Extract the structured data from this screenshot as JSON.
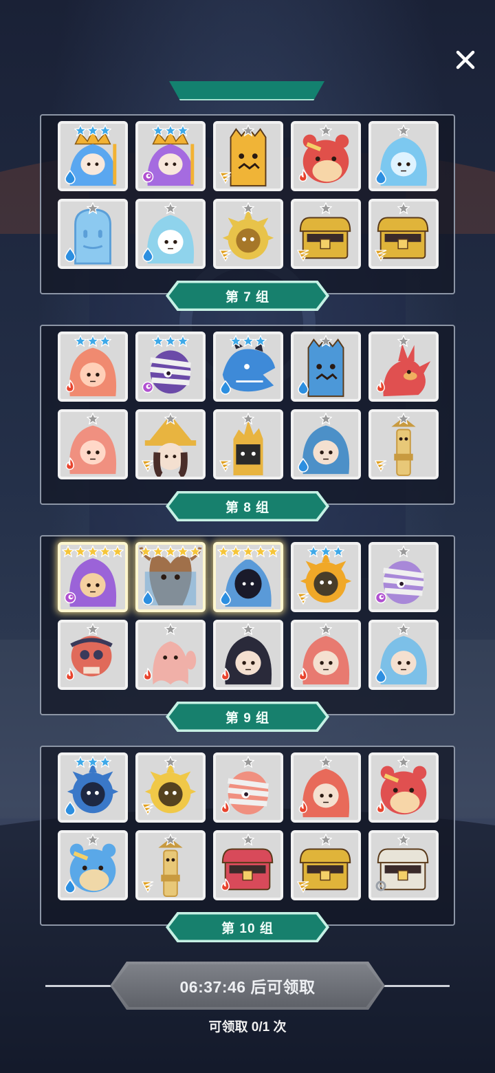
{
  "close_label": "✕",
  "groups": [
    {
      "label": "第 7 组",
      "cards": [
        {
          "stars": 3,
          "star_color": "blue",
          "element": "water",
          "color": "#5aa7f0",
          "accent": "#f2b233",
          "shape": "crown"
        },
        {
          "stars": 3,
          "star_color": "blue",
          "element": "dark",
          "color": "#a56be0",
          "accent": "#f2b233",
          "shape": "crown"
        },
        {
          "stars": 1,
          "star_color": "gray",
          "element": "wind",
          "color": "#f0b437",
          "accent": "#7a4a1a",
          "shape": "stump"
        },
        {
          "stars": 1,
          "star_color": "gray",
          "element": "fire",
          "color": "#e0504a",
          "accent": "#f7d6a8",
          "shape": "bear"
        },
        {
          "stars": 1,
          "star_color": "gray",
          "element": "water",
          "color": "#7cc8f0",
          "accent": "#dff3ff",
          "shape": "girl"
        },
        {
          "stars": 1,
          "star_color": "gray",
          "element": "water",
          "color": "#8cc9f0",
          "accent": "#5b9fd8",
          "shape": "blob"
        },
        {
          "stars": 1,
          "star_color": "gray",
          "element": "water",
          "color": "#8fd3ec",
          "accent": "#ffffff",
          "shape": "girl"
        },
        {
          "stars": 1,
          "star_color": "gray",
          "element": "wind",
          "color": "#e8c34a",
          "accent": "#9a6a22",
          "shape": "sun"
        },
        {
          "stars": 1,
          "star_color": "gray",
          "element": "wind",
          "color": "#e0b43a",
          "accent": "#3a2a2a",
          "shape": "chest"
        },
        {
          "stars": 1,
          "star_color": "gray",
          "element": "wind",
          "color": "#e0b43a",
          "accent": "#3a2a2a",
          "shape": "chest"
        }
      ]
    },
    {
      "label": "第 8 组",
      "cards": [
        {
          "stars": 3,
          "star_color": "blue",
          "element": "fire",
          "color": "#f08a70",
          "accent": "#ffd0b8",
          "shape": "girl"
        },
        {
          "stars": 3,
          "star_color": "blue",
          "element": "dark",
          "color": "#6b4aa8",
          "accent": "#f0f0f0",
          "shape": "mummy"
        },
        {
          "stars": 3,
          "star_color": "blue",
          "element": "water",
          "color": "#3e8ad8",
          "accent": "#2a2a3a",
          "shape": "dragon"
        },
        {
          "stars": 1,
          "star_color": "gray",
          "element": "water",
          "color": "#4c98d8",
          "accent": "#1e3a5a",
          "shape": "stump"
        },
        {
          "stars": 1,
          "star_color": "gray",
          "element": "fire",
          "color": "#e05050",
          "accent": "#f0b060",
          "shape": "bird"
        },
        {
          "stars": 1,
          "star_color": "gray",
          "element": "fire",
          "color": "#f09080",
          "accent": "#ffd8c8",
          "shape": "girl"
        },
        {
          "stars": 1,
          "star_color": "gray",
          "element": "wind",
          "color": "#e8b440",
          "accent": "#4a2e2a",
          "shape": "witch"
        },
        {
          "stars": 1,
          "star_color": "gray",
          "element": "wind",
          "color": "#e8b440",
          "accent": "#2a2a2a",
          "shape": "tower"
        },
        {
          "stars": 1,
          "star_color": "gray",
          "element": "water",
          "color": "#4c90c8",
          "accent": "#f4e0d0",
          "shape": "girl"
        },
        {
          "stars": 1,
          "star_color": "gray",
          "element": "wind",
          "color": "#e8c878",
          "accent": "#c89a40",
          "shape": "totem"
        }
      ]
    },
    {
      "label": "第 9 组",
      "cards": [
        {
          "stars": 5,
          "star_color": "gold",
          "element": "dark",
          "color": "#9b63d8",
          "accent": "#f4d0a0",
          "shape": "girl",
          "glow": true
        },
        {
          "stars": 5,
          "star_color": "gold",
          "element": "water",
          "color": "#6aa8d8",
          "accent": "#a0704a",
          "shape": "horse",
          "glow": true
        },
        {
          "stars": 5,
          "star_color": "gold",
          "element": "water",
          "color": "#5a9ad8",
          "accent": "#1a1a2a",
          "shape": "hood",
          "glow": true
        },
        {
          "stars": 3,
          "star_color": "blue",
          "element": "wind",
          "color": "#f0a828",
          "accent": "#2a2a2a",
          "shape": "sun"
        },
        {
          "stars": 1,
          "star_color": "gray",
          "element": "dark",
          "color": "#a888d8",
          "accent": "#f0f0f0",
          "shape": "mummy"
        },
        {
          "stars": 1,
          "star_color": "gray",
          "element": "fire",
          "color": "#e06a5a",
          "accent": "#3a3a5a",
          "shape": "skull"
        },
        {
          "stars": 1,
          "star_color": "gray",
          "element": "fire",
          "color": "#f0b0a8",
          "accent": "#ffffff",
          "shape": "ghost"
        },
        {
          "stars": 1,
          "star_color": "gray",
          "element": "fire",
          "color": "#2a2a3a",
          "accent": "#f4e0d0",
          "shape": "girl"
        },
        {
          "stars": 1,
          "star_color": "gray",
          "element": "fire",
          "color": "#e87a70",
          "accent": "#f4e0d0",
          "shape": "girl"
        },
        {
          "stars": 1,
          "star_color": "gray",
          "element": "water",
          "color": "#7cc0e8",
          "accent": "#f4e0d0",
          "shape": "girl"
        }
      ]
    },
    {
      "label": "第 10 组",
      "cards": [
        {
          "stars": 3,
          "star_color": "blue",
          "element": "water",
          "color": "#3a78c8",
          "accent": "#1a1a2a",
          "shape": "sun"
        },
        {
          "stars": 1,
          "star_color": "gray",
          "element": "wind",
          "color": "#f0c848",
          "accent": "#3a2a1a",
          "shape": "sun"
        },
        {
          "stars": 1,
          "star_color": "gray",
          "element": "fire",
          "color": "#f09080",
          "accent": "#f0f0f0",
          "shape": "mummy"
        },
        {
          "stars": 1,
          "star_color": "gray",
          "element": "fire",
          "color": "#e86a5a",
          "accent": "#f4e0d0",
          "shape": "girl"
        },
        {
          "stars": 1,
          "star_color": "gray",
          "element": "fire",
          "color": "#e05050",
          "accent": "#f7d6a8",
          "shape": "bear"
        },
        {
          "stars": 1,
          "star_color": "gray",
          "element": "water",
          "color": "#5aa8e8",
          "accent": "#f0d8a8",
          "shape": "bear"
        },
        {
          "stars": 1,
          "star_color": "gray",
          "element": "wind",
          "color": "#e8c878",
          "accent": "#c89a40",
          "shape": "totem"
        },
        {
          "stars": 1,
          "star_color": "gray",
          "element": "fire",
          "color": "#d84a5a",
          "accent": "#3a2a2a",
          "shape": "chest"
        },
        {
          "stars": 1,
          "star_color": "gray",
          "element": "wind",
          "color": "#e0b43a",
          "accent": "#3a2a2a",
          "shape": "chest"
        },
        {
          "stars": 1,
          "star_color": "gray",
          "element": "light",
          "color": "#e8e4d8",
          "accent": "#3a2a2a",
          "shape": "chest"
        }
      ]
    }
  ],
  "claim_button_label": "06:37:46 后可领取",
  "claim_count_label": "可领取 0/1 次",
  "colors": {
    "banner": "#17806d",
    "card_bg": "#d9d9d9",
    "star_blue": "#3fa9e8",
    "star_gold": "#f5c53a",
    "star_gray": "#9a9a9a",
    "water": "#2d8fe0",
    "fire": "#e8442e",
    "wind": "#e0a020",
    "dark": "#b050d0",
    "light": "#9aa0a8"
  }
}
